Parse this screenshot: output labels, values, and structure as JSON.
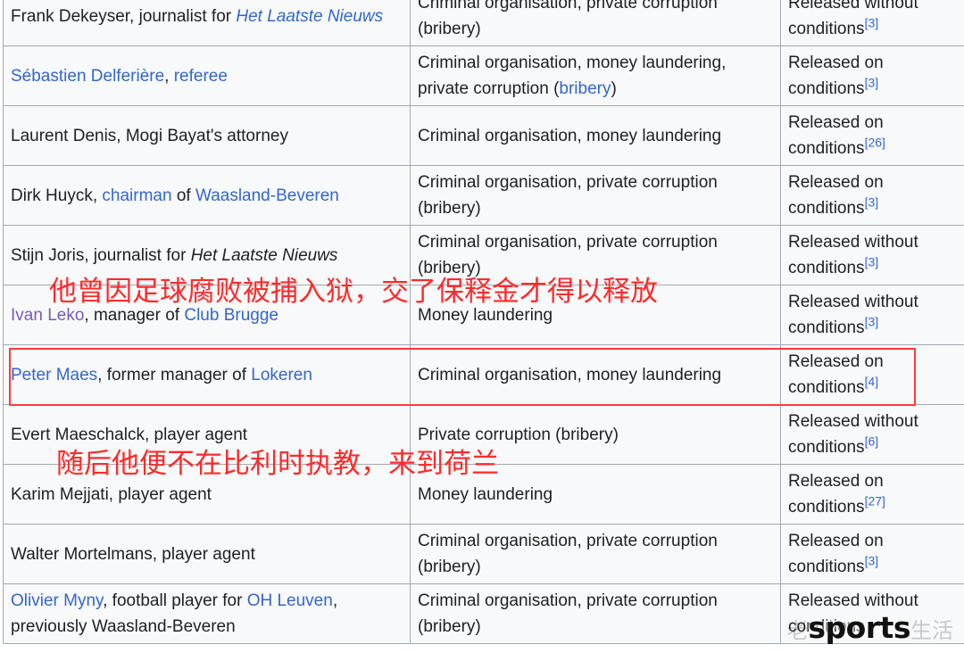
{
  "rows": [
    {
      "name_parts": [
        {
          "text": "Frank Dekeyser, journalist for "
        },
        {
          "text": "Het Laatste Nieuws",
          "link": true,
          "italic": true
        }
      ],
      "charge_parts": [
        {
          "text": "Criminal organisation, private corruption (bribery)"
        }
      ],
      "outcome": "Released without conditions",
      "ref": "[3]"
    },
    {
      "name_parts": [
        {
          "text": "Sébastien Delferière",
          "link": true
        },
        {
          "text": ", "
        },
        {
          "text": "referee",
          "link": true
        }
      ],
      "charge_parts": [
        {
          "text": "Criminal organisation, money laundering, private corruption ("
        },
        {
          "text": "bribery",
          "link": true
        },
        {
          "text": ")"
        }
      ],
      "outcome": "Released on conditions",
      "ref": "[3]"
    },
    {
      "name_parts": [
        {
          "text": "Laurent Denis, Mogi Bayat's attorney"
        }
      ],
      "charge_parts": [
        {
          "text": "Criminal organisation, money laundering"
        }
      ],
      "outcome": "Released on conditions",
      "ref": "[26]"
    },
    {
      "name_parts": [
        {
          "text": "Dirk Huyck, "
        },
        {
          "text": "chairman",
          "link": true
        },
        {
          "text": " of "
        },
        {
          "text": "Waasland-Beveren",
          "link": true
        }
      ],
      "charge_parts": [
        {
          "text": "Criminal organisation, private corruption (bribery)"
        }
      ],
      "outcome": "Released on conditions",
      "ref": "[3]"
    },
    {
      "name_parts": [
        {
          "text": "Stijn Joris, journalist for "
        },
        {
          "text": "Het Laatste Nieuws",
          "italic": true
        }
      ],
      "charge_parts": [
        {
          "text": "Criminal organisation, private corruption (bribery)"
        }
      ],
      "outcome": "Released without conditions",
      "ref": "[3]"
    },
    {
      "name_parts": [
        {
          "text": "Ivan Leko",
          "link": true,
          "visited": true
        },
        {
          "text": ", manager of "
        },
        {
          "text": "Club Brugge",
          "link": true
        }
      ],
      "charge_parts": [
        {
          "text": "Money laundering"
        }
      ],
      "outcome": "Released without conditions",
      "ref": "[3]"
    },
    {
      "name_parts": [
        {
          "text": "Peter Maes",
          "link": true
        },
        {
          "text": ", former manager of "
        },
        {
          "text": "Lokeren",
          "link": true
        }
      ],
      "charge_parts": [
        {
          "text": "Criminal organisation, money laundering"
        }
      ],
      "outcome": "Released on conditions",
      "ref": "[4]"
    },
    {
      "name_parts": [
        {
          "text": "Evert Maeschalck, player agent"
        }
      ],
      "charge_parts": [
        {
          "text": "Private corruption (bribery)"
        }
      ],
      "outcome": "Released without conditions",
      "ref": "[6]"
    },
    {
      "name_parts": [
        {
          "text": "Karim Mejjati, player agent"
        }
      ],
      "charge_parts": [
        {
          "text": "Money laundering"
        }
      ],
      "outcome": "Released on conditions",
      "ref": "[27]"
    },
    {
      "name_parts": [
        {
          "text": "Walter Mortelmans, player agent"
        }
      ],
      "charge_parts": [
        {
          "text": "Criminal organisation, private corruption (bribery)"
        }
      ],
      "outcome": "Released on conditions",
      "ref": "[3]"
    },
    {
      "name_parts": [
        {
          "text": "Olivier Myny",
          "link": true
        },
        {
          "text": ", football player for "
        },
        {
          "text": "OH Leuven",
          "link": true
        },
        {
          "text": ", previously Waasland-Beveren"
        }
      ],
      "charge_parts": [
        {
          "text": "Criminal organisation, private corruption (bribery)"
        }
      ],
      "outcome": "Released without conditions",
      "ref": ""
    }
  ],
  "overlay": {
    "caption_1": "他曾因足球腐败被捕入狱，交了保释金才得以释放",
    "caption_2": "随后他便不在比利时执教，来到荷兰",
    "highlight_color": "#ff3a3a",
    "text_color": "#ff2a2a"
  },
  "watermark": {
    "faint": "老",
    "bold": "sports",
    "trail": "生活"
  },
  "colors": {
    "link": "#3366cc",
    "visited_link": "#795cb2",
    "cell_background": "#f8f9fa",
    "border": "#a2a9b1"
  }
}
